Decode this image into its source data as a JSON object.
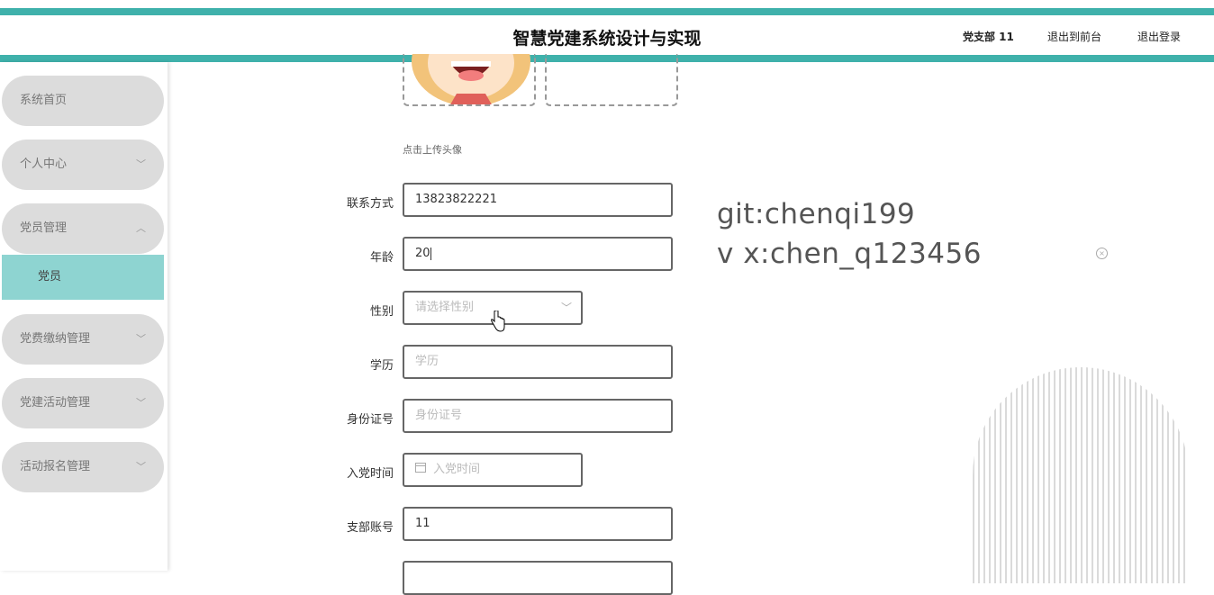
{
  "header": {
    "title": "智慧党建系统设计与实现",
    "user": "党支部 11",
    "front_link": "退出到前台",
    "logout_link": "退出登录"
  },
  "sidebar": {
    "items": [
      {
        "label": "系统首页"
      },
      {
        "label": "个人中心"
      },
      {
        "label": "党员管理"
      },
      {
        "label": "党费缴纳管理"
      },
      {
        "label": "党建活动管理"
      },
      {
        "label": "活动报名管理"
      }
    ],
    "sub_active": "党员"
  },
  "form": {
    "upload_hint": "点击上传头像",
    "phone": {
      "label": "联系方式",
      "value": "13823822221"
    },
    "age": {
      "label": "年龄",
      "value": "20"
    },
    "gender": {
      "label": "性别",
      "placeholder": "请选择性别"
    },
    "education": {
      "label": "学历",
      "placeholder": "学历"
    },
    "id_card": {
      "label": "身份证号",
      "placeholder": "身份证号"
    },
    "join_date": {
      "label": "入党时间",
      "placeholder": "入党时间"
    },
    "branch_account": {
      "label": "支部账号",
      "value": "11"
    }
  },
  "watermark": {
    "line1": "git:chenqi199",
    "line2": "v x:chen_q123456"
  },
  "colors": {
    "accent": "#3fb1ab",
    "active_menu": "#8ed4d1",
    "menu_bg": "#dcdcdc"
  }
}
